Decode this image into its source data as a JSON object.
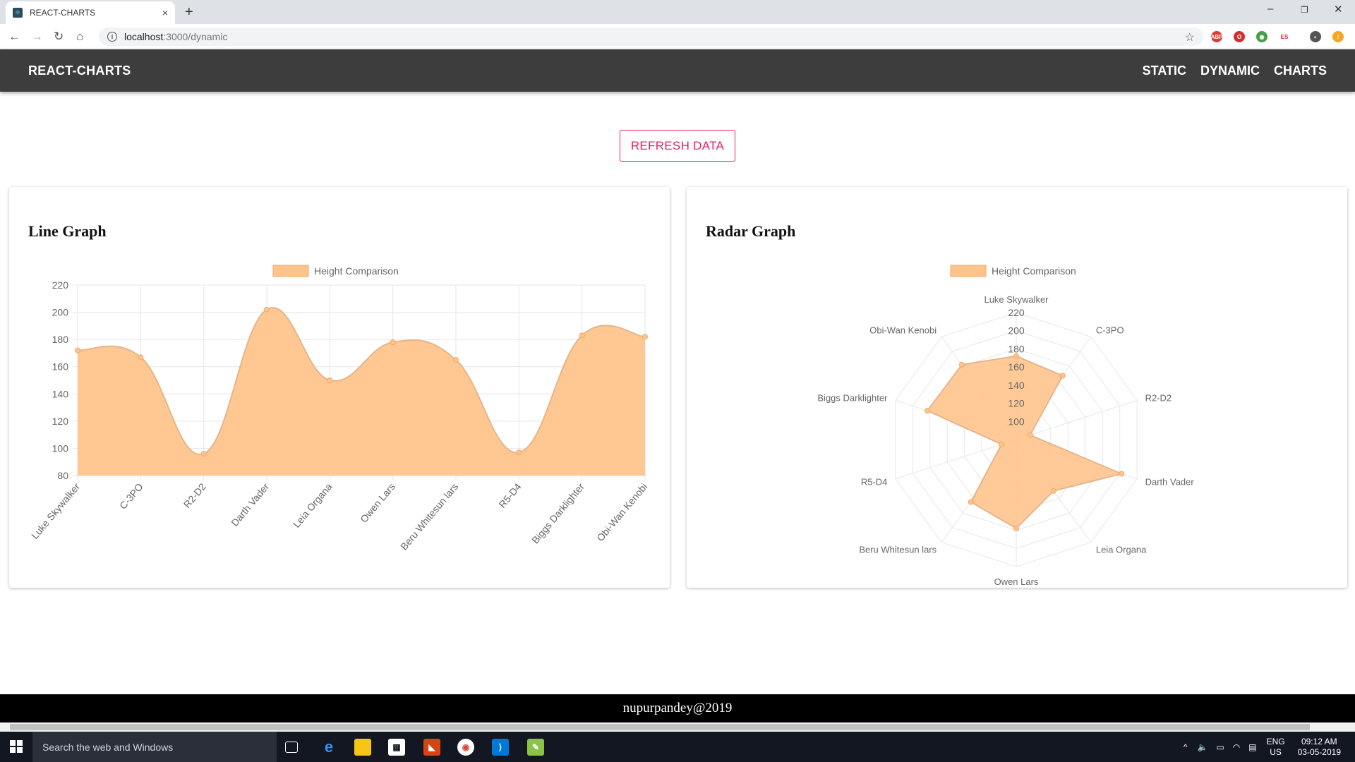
{
  "browser": {
    "tab_title": "REACT-CHARTS",
    "tab_close": "×",
    "new_tab": "+",
    "url_host": "localhost",
    "url_rest": ":3000/dynamic",
    "win_min": "–",
    "win_max": "❐",
    "win_close": "✕"
  },
  "navbar": {
    "brand": "REACT-CHARTS",
    "links": [
      "STATIC",
      "DYNAMIC",
      "CHARTS"
    ]
  },
  "refresh_button": "REFRESH DATA",
  "line_card": {
    "title": "Line Graph"
  },
  "radar_card": {
    "title": "Radar Graph"
  },
  "footer": "nupurpandey@2019",
  "taskbar": {
    "search_placeholder": "Search the web and Windows",
    "lang": "ENG",
    "region": "US",
    "time": "09:12 AM",
    "date": "03-05-2019"
  },
  "colors": {
    "fill": "#ffc48c",
    "stroke": "#f0a868",
    "accent": "#e91e63",
    "navbar": "#3d3d3d"
  },
  "chart_data": [
    {
      "type": "area",
      "legend": "Height Comparison",
      "categories": [
        "Luke Skywalker",
        "C-3PO",
        "R2-D2",
        "Darth Vader",
        "Leia Organa",
        "Owen Lars",
        "Beru Whitesun lars",
        "R5-D4",
        "Biggs Darklighter",
        "Obi-Wan Kenobi"
      ],
      "values": [
        172,
        167,
        96,
        202,
        150,
        178,
        165,
        97,
        183,
        182
      ],
      "ylim": [
        80,
        220
      ],
      "yticks": [
        80,
        100,
        120,
        140,
        160,
        180,
        200,
        220
      ],
      "grid": true,
      "legend_position": "top"
    },
    {
      "type": "radar",
      "legend": "Height Comparison",
      "categories": [
        "Luke Skywalker",
        "C-3PO",
        "R2-D2",
        "Darth Vader",
        "Leia Organa",
        "Owen Lars",
        "Beru Whitesun lars",
        "R5-D4",
        "Biggs Darklighter",
        "Obi-Wan Kenobi"
      ],
      "values": [
        172,
        167,
        96,
        202,
        150,
        178,
        165,
        97,
        183,
        182
      ],
      "rlim": [
        80,
        220
      ],
      "rticks": [
        100,
        120,
        140,
        160,
        180,
        200,
        220
      ],
      "grid": true,
      "legend_position": "top"
    }
  ]
}
